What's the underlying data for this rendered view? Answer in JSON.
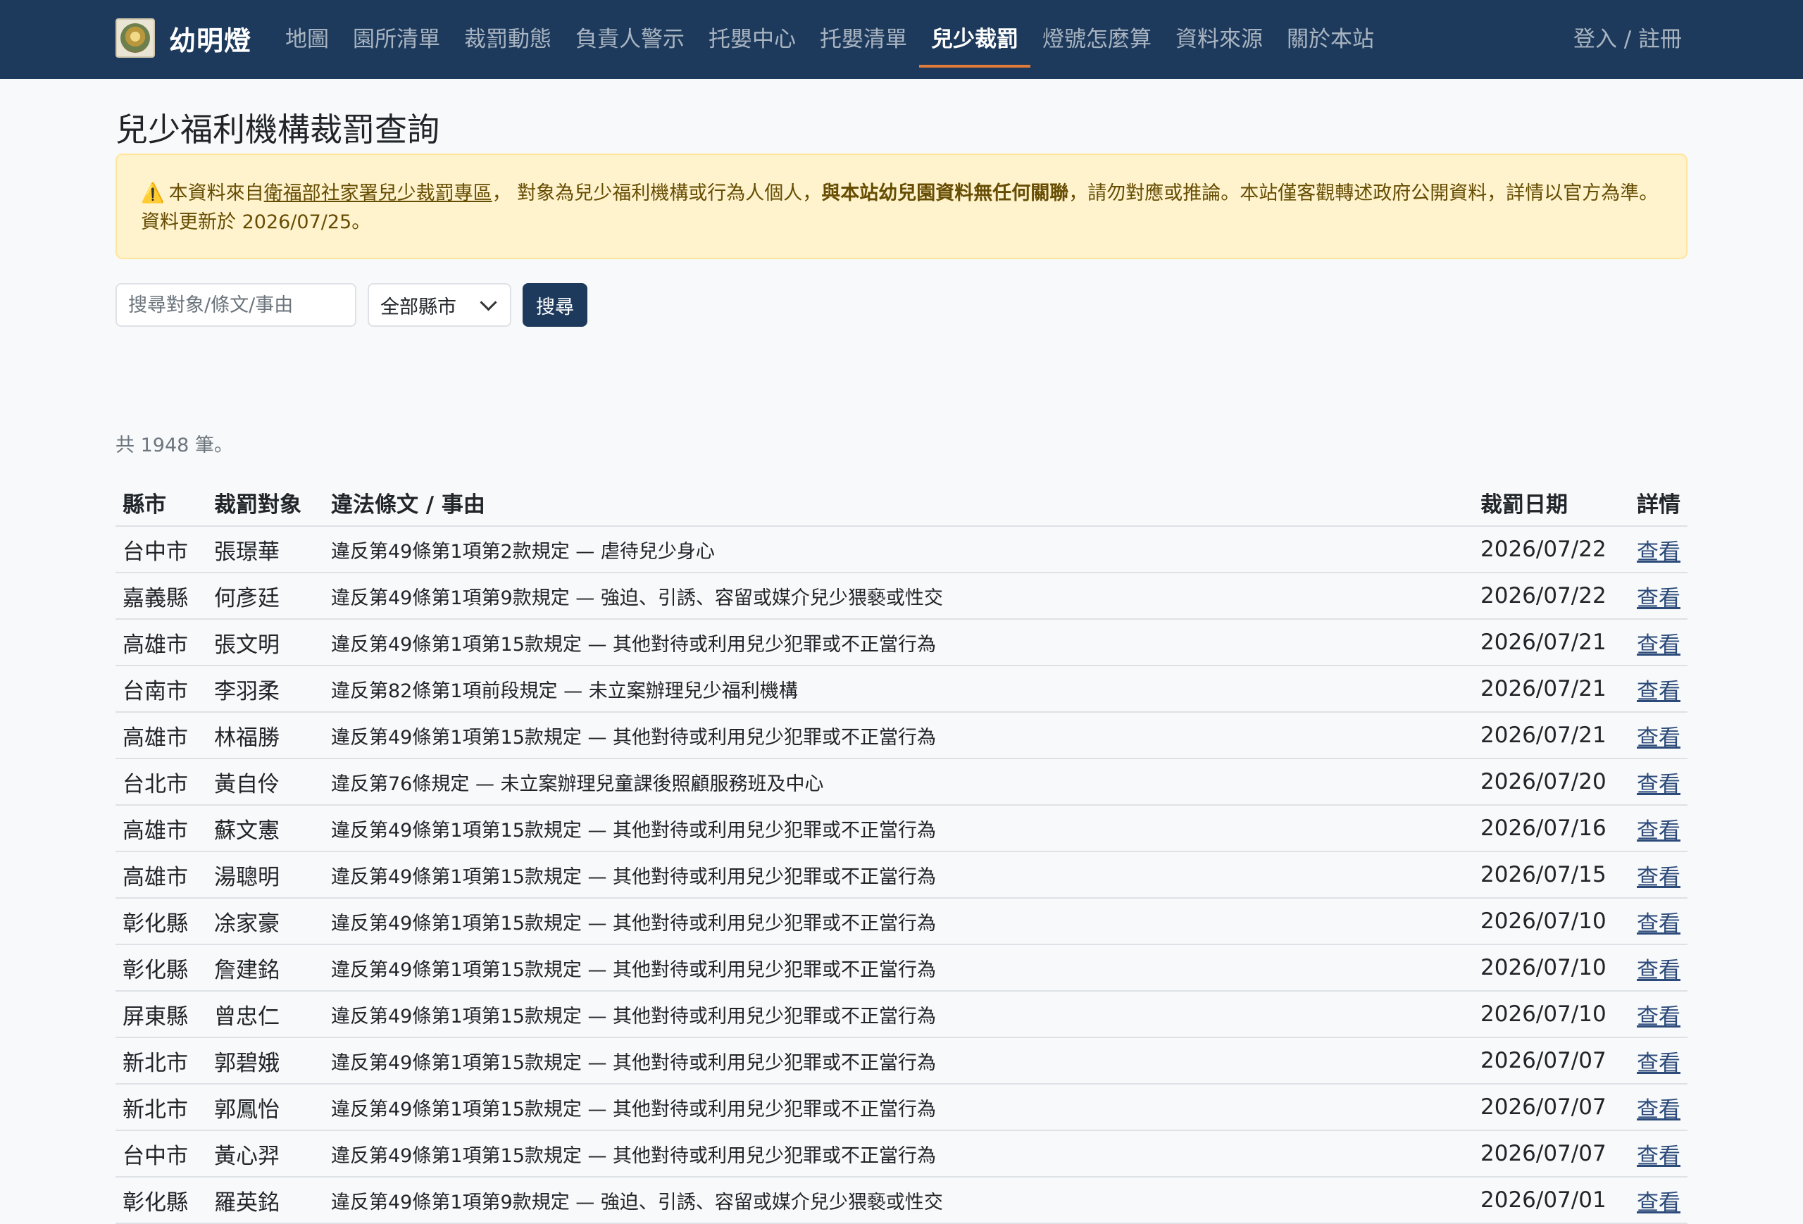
{
  "brand": {
    "name": "幼明燈",
    "logo_icon": "lamp-logo-icon"
  },
  "nav": [
    {
      "label": "地圖",
      "active": false
    },
    {
      "label": "園所清單",
      "active": false
    },
    {
      "label": "裁罰動態",
      "active": false
    },
    {
      "label": "負責人警示",
      "active": false
    },
    {
      "label": "托嬰中心",
      "active": false
    },
    {
      "label": "托嬰清單",
      "active": false
    },
    {
      "label": "兒少裁罰",
      "active": true
    },
    {
      "label": "燈號怎麼算",
      "active": false
    },
    {
      "label": "資料來源",
      "active": false
    },
    {
      "label": "關於本站",
      "active": false
    }
  ],
  "auth": {
    "label": "登入 / 註冊"
  },
  "page": {
    "title": "兒少福利機構裁罰查詢"
  },
  "alert": {
    "prefix": "本資料來自",
    "link": "衛福部社家署兒少裁罰專區",
    "middle": "， 對象為兒少福利機構或行為人個人，",
    "bold": "與本站幼兒園資料無任何關聯",
    "suffix": "，請勿對應或推論。本站僅客觀轉述政府公開資料，詳情以官方為準。 資料更新於 2026/07/25。"
  },
  "search": {
    "placeholder": "搜尋對象/條文/事由",
    "select_value": "全部縣市",
    "button": "搜尋"
  },
  "result_count": "共 1948 筆。",
  "table": {
    "headers": {
      "city": "縣市",
      "target": "裁罰對象",
      "reason": "違法條文 / 事由",
      "date": "裁罰日期",
      "detail": "詳情"
    },
    "rows": [
      {
        "city": "台中市",
        "target": "張璟華",
        "reason": "違反第49條第1項第2款規定 — 虐待兒少身心",
        "date": "2026/07/22",
        "link": "查看"
      },
      {
        "city": "嘉義縣",
        "target": "何彥廷",
        "reason": "違反第49條第1項第9款規定 — 強迫、引誘、容留或媒介兒少猥褻或性交",
        "date": "2026/07/22",
        "link": "查看"
      },
      {
        "city": "高雄市",
        "target": "張文明",
        "reason": "違反第49條第1項第15款規定 — 其他對待或利用兒少犯罪或不正當行為",
        "date": "2026/07/21",
        "link": "查看"
      },
      {
        "city": "台南市",
        "target": "李羽柔",
        "reason": "違反第82條第1項前段規定 — 未立案辦理兒少福利機構",
        "date": "2026/07/21",
        "link": "查看"
      },
      {
        "city": "高雄市",
        "target": "林福勝",
        "reason": "違反第49條第1項第15款規定 — 其他對待或利用兒少犯罪或不正當行為",
        "date": "2026/07/21",
        "link": "查看"
      },
      {
        "city": "台北市",
        "target": "黃自伶",
        "reason": "違反第76條規定 — 未立案辦理兒童課後照顧服務班及中心",
        "date": "2026/07/20",
        "link": "查看"
      },
      {
        "city": "高雄市",
        "target": "蘇文憲",
        "reason": "違反第49條第1項第15款規定 — 其他對待或利用兒少犯罪或不正當行為",
        "date": "2026/07/16",
        "link": "查看"
      },
      {
        "city": "高雄市",
        "target": "湯聰明",
        "reason": "違反第49條第1項第15款規定 — 其他對待或利用兒少犯罪或不正當行為",
        "date": "2026/07/15",
        "link": "查看"
      },
      {
        "city": "彰化縣",
        "target": "凃家豪",
        "reason": "違反第49條第1項第15款規定 — 其他對待或利用兒少犯罪或不正當行為",
        "date": "2026/07/10",
        "link": "查看"
      },
      {
        "city": "彰化縣",
        "target": "詹建銘",
        "reason": "違反第49條第1項第15款規定 — 其他對待或利用兒少犯罪或不正當行為",
        "date": "2026/07/10",
        "link": "查看"
      },
      {
        "city": "屏東縣",
        "target": "曾忠仁",
        "reason": "違反第49條第1項第15款規定 — 其他對待或利用兒少犯罪或不正當行為",
        "date": "2026/07/10",
        "link": "查看"
      },
      {
        "city": "新北市",
        "target": "郭碧娥",
        "reason": "違反第49條第1項第15款規定 — 其他對待或利用兒少犯罪或不正當行為",
        "date": "2026/07/07",
        "link": "查看"
      },
      {
        "city": "新北市",
        "target": "郭鳳怡",
        "reason": "違反第49條第1項第15款規定 — 其他對待或利用兒少犯罪或不正當行為",
        "date": "2026/07/07",
        "link": "查看"
      },
      {
        "city": "台中市",
        "target": "黃心羿",
        "reason": "違反第49條第1項第15款規定 — 其他對待或利用兒少犯罪或不正當行為",
        "date": "2026/07/07",
        "link": "查看"
      },
      {
        "city": "彰化縣",
        "target": "羅英銘",
        "reason": "違反第49條第1項第9款規定 — 強迫、引誘、容留或媒介兒少猥褻或性交",
        "date": "2026/07/01",
        "link": "查看"
      }
    ]
  }
}
